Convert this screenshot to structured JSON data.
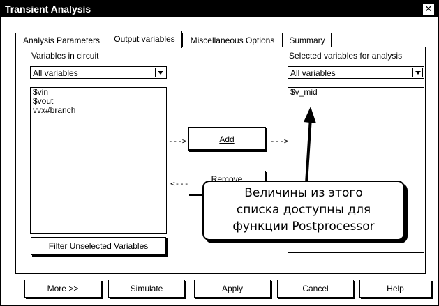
{
  "window": {
    "title": "Transient Analysis",
    "close_glyph": "✕"
  },
  "tabs": [
    {
      "label": "Analysis Parameters"
    },
    {
      "label": "Output variables"
    },
    {
      "label": "Miscellaneous Options"
    },
    {
      "label": "Summary"
    }
  ],
  "left": {
    "heading": "Variables in circuit",
    "filter_selected": "All variables",
    "items": [
      "$vin",
      "$vout",
      "vvx#branch"
    ],
    "filter_button": "Filter Unselected Variables"
  },
  "right": {
    "heading": "Selected variables for analysis",
    "filter_selected": "All variables",
    "items": [
      "$v_mid"
    ]
  },
  "middle": {
    "add_label": "Add",
    "remove_label": "Remove",
    "add_arrow_left": "--->",
    "add_arrow_right": "--->",
    "remove_arrow": "<---"
  },
  "callout": {
    "lines": [
      "Величины из этого",
      "списка доступны для",
      "функции Postprocessor"
    ]
  },
  "footer": {
    "more": "More >>",
    "simulate": "Simulate",
    "apply": "Apply",
    "cancel": "Cancel",
    "help": "Help"
  }
}
